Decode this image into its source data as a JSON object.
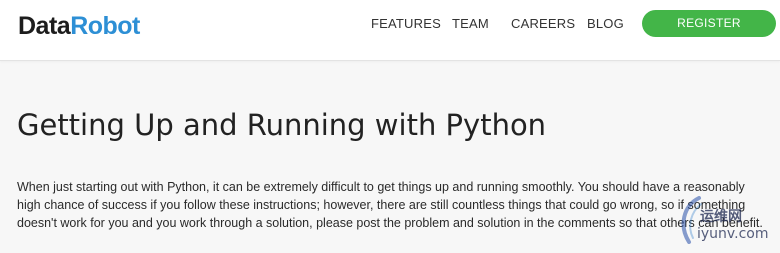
{
  "header": {
    "logo_part1": "Data",
    "logo_part2": "Robot",
    "nav": {
      "features": "FEATURES",
      "team": "TEAM",
      "careers": "CAREERS",
      "blog": "BLOG"
    },
    "register_label": "REGISTER"
  },
  "main": {
    "title": "Getting Up and Running with Python",
    "intro": "When just starting out with Python, it can be extremely difficult to get things up and running smoothly. You should have a reasonably high chance of success if you follow these instructions; however, there are still countless things that could go wrong, so if something doesn't work for you and you work through a solution, please post the problem and solution in the comments so that others can benefit."
  },
  "watermark": {
    "site": "运维网",
    "domain": "iyunv.com"
  },
  "colors": {
    "brand_blue": "#2d8fd5",
    "register_green": "#43b548",
    "page_background": "#f7f7f7"
  }
}
